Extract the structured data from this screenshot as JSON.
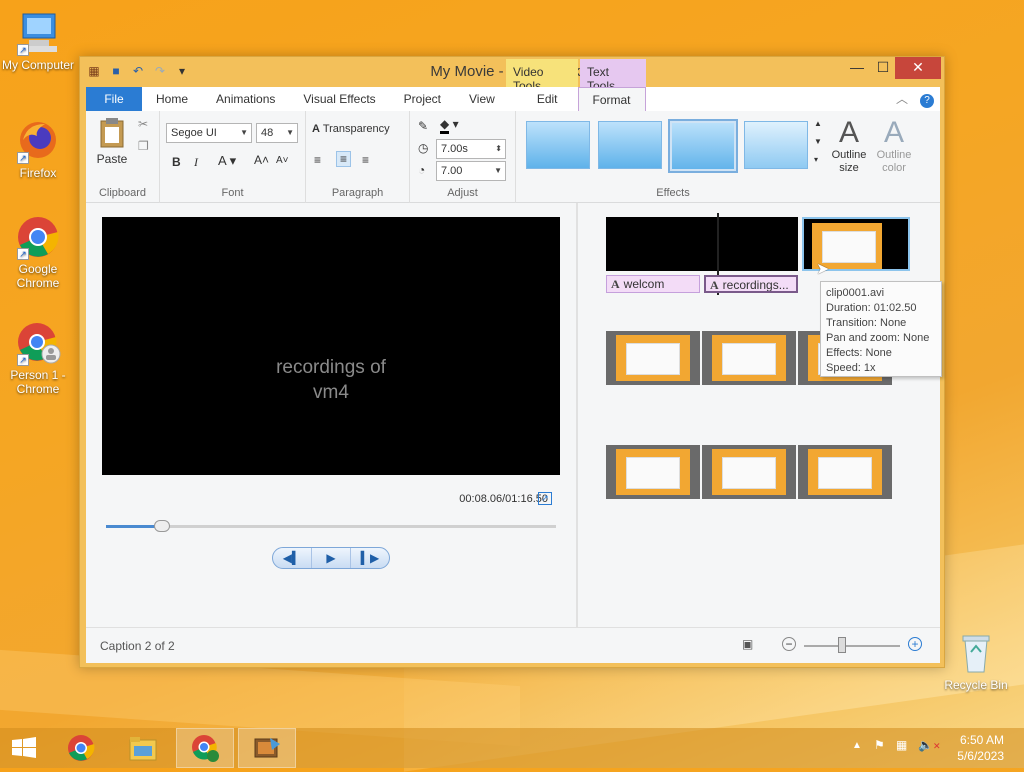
{
  "desktop": {
    "icons": [
      {
        "label": "My Computer"
      },
      {
        "label": "Firefox"
      },
      {
        "label": "Google Chrome"
      },
      {
        "label": "Person 1 - Chrome"
      },
      {
        "label": "Recycle Bin"
      }
    ]
  },
  "window": {
    "title": "My Movie - Movie Maker",
    "contextual_tabs": {
      "video_tools": "Video Tools",
      "text_tools": "Text Tools"
    }
  },
  "ribbon": {
    "tabs": [
      "File",
      "Home",
      "Animations",
      "Visual Effects",
      "Project",
      "View",
      "Edit",
      "Format"
    ],
    "active_tab": "Format",
    "clipboard": {
      "paste": "Paste",
      "group": "Clipboard"
    },
    "font": {
      "family": "Segoe UI",
      "size": "48",
      "group": "Font"
    },
    "paragraph": {
      "transparency": "Transparency",
      "group": "Paragraph"
    },
    "adjust": {
      "start_time": "7.00s",
      "duration": "7.00",
      "group": "Adjust"
    },
    "effects": {
      "group": "Effects"
    },
    "outline": {
      "size": "Outline size",
      "color": "Outline color"
    }
  },
  "preview": {
    "caption_line1": "recordings of",
    "caption_line2": "vm4",
    "timecode": "00:08.06/01:16.50",
    "progress": 0.11
  },
  "storyboard": {
    "captions": [
      "welcom",
      "recordings..."
    ],
    "tooltip": {
      "file": "clip0001.avi",
      "duration": "Duration: 01:02.50",
      "transition": "Transition: None",
      "pan": "Pan and zoom: None",
      "effects": "Effects: None",
      "speed": "Speed: 1x"
    }
  },
  "status": {
    "text": "Caption 2 of 2"
  },
  "taskbar": {
    "time": "6:50 AM",
    "date": "5/6/2023"
  },
  "colors": {
    "file_tab": "#2b7cd3",
    "close": "#c7463b",
    "text_tools": "#e6c8f0",
    "video_tools": "#f7e27a"
  }
}
